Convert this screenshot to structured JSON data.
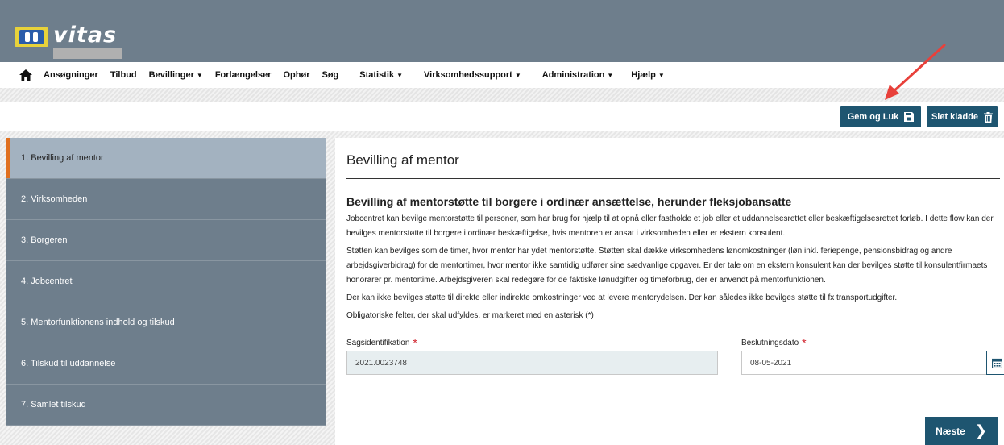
{
  "app": {
    "logo_text": "vitas"
  },
  "nav": {
    "items": [
      {
        "label": "Ansøgninger",
        "has_menu": false
      },
      {
        "label": "Tilbud",
        "has_menu": false
      },
      {
        "label": "Bevillinger",
        "has_menu": true
      },
      {
        "label": "Forlængelser",
        "has_menu": false
      },
      {
        "label": "Ophør",
        "has_menu": false
      },
      {
        "label": "Søg",
        "has_menu": false
      },
      {
        "label": "Statistik",
        "has_menu": true
      },
      {
        "label": "Virksomhedssupport",
        "has_menu": true
      },
      {
        "label": "Administration",
        "has_menu": true
      },
      {
        "label": "Hjælp",
        "has_menu": true
      }
    ],
    "caret": "▼"
  },
  "toolbar": {
    "save_label": "Gem og Luk",
    "delete_label": "Slet kladde"
  },
  "sidebar": {
    "items": [
      {
        "label": "1. Bevilling af mentor",
        "active": true
      },
      {
        "label": "2. Virksomheden",
        "active": false
      },
      {
        "label": "3. Borgeren",
        "active": false
      },
      {
        "label": "4. Jobcentret",
        "active": false
      },
      {
        "label": "5. Mentorfunktionens indhold og tilskud",
        "active": false
      },
      {
        "label": "6. Tilskud til uddannelse",
        "active": false
      },
      {
        "label": "7. Samlet tilskud",
        "active": false
      }
    ]
  },
  "main": {
    "title": "Bevilling af mentor",
    "section_title": "Bevilling af mentorstøtte til borgere i ordinær ansættelse, herunder fleksjobansatte",
    "paragraphs": [
      "Jobcentret kan bevilge mentorstøtte til personer, som har brug for hjælp til at opnå eller fastholde et job eller et uddannelsesrettet eller beskæftigelsesrettet forløb. I dette flow kan der bevilges mentorstøtte til borgere i ordinær beskæftigelse, hvis mentoren er ansat i virksomheden eller er ekstern konsulent.",
      "Støtten kan bevilges som de timer, hvor mentor har ydet mentorstøtte. Støtten skal dække virksomhedens lønomkostninger (løn inkl. feriepenge, pensionsbidrag og andre arbejdsgiverbidrag) for de mentortimer, hvor mentor ikke samtidig udfører sine sædvanlige opgaver. Er der tale om en ekstern konsulent kan der bevilges støtte til konsulentfirmaets honorarer pr. mentortime. Arbejdsgiveren skal redegøre for de faktiske lønudgifter og timeforbrug, der er anvendt på mentorfunktionen.",
      "Der kan ikke bevilges støtte til direkte eller indirekte omkostninger ved at levere mentorydelsen. Der kan således ikke bevilges støtte til fx transportudgifter.",
      "Obligatoriske felter, der skal udfyldes, er markeret med en asterisk (*)"
    ],
    "case_id": {
      "label": "Sagsidentifikation",
      "required_mark": "*",
      "value": "2021.0023748"
    },
    "decision_date": {
      "label": "Beslutningsdato",
      "required_mark": "*",
      "value": "08-05-2021"
    },
    "next_label": "Næste",
    "next_chevron": "❯"
  },
  "colors": {
    "banner": "#6e7e8c",
    "button": "#1e5570",
    "active_marker": "#e07020",
    "required": "#d0202a",
    "annotation": "#e8403a"
  },
  "icons": {
    "home": "home-icon",
    "save": "floppy-disk-icon",
    "delete": "trash-icon",
    "calendar": "calendar-icon",
    "next": "chevron-right-icon"
  }
}
